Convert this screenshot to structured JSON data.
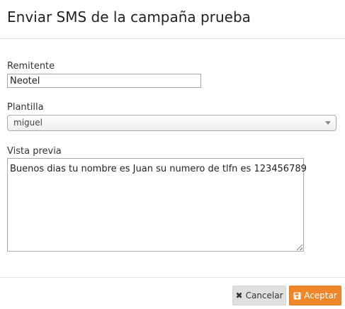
{
  "header": {
    "title": "Enviar SMS de la campaña prueba"
  },
  "form": {
    "sender": {
      "label": "Remitente",
      "value": "Neotel"
    },
    "template": {
      "label": "Plantilla",
      "selected": "miguel"
    },
    "preview": {
      "label": "Vista previa",
      "text": "Buenos dias tu nombre es Juan su numero de tlfn es 123456789"
    }
  },
  "footer": {
    "cancel_label": "Cancelar",
    "cancel_icon": "close-icon",
    "accept_label": "Aceptar",
    "accept_icon": "save-icon"
  },
  "colors": {
    "accept_button": "#f0862a",
    "cancel_button": "#e0e0e0"
  }
}
